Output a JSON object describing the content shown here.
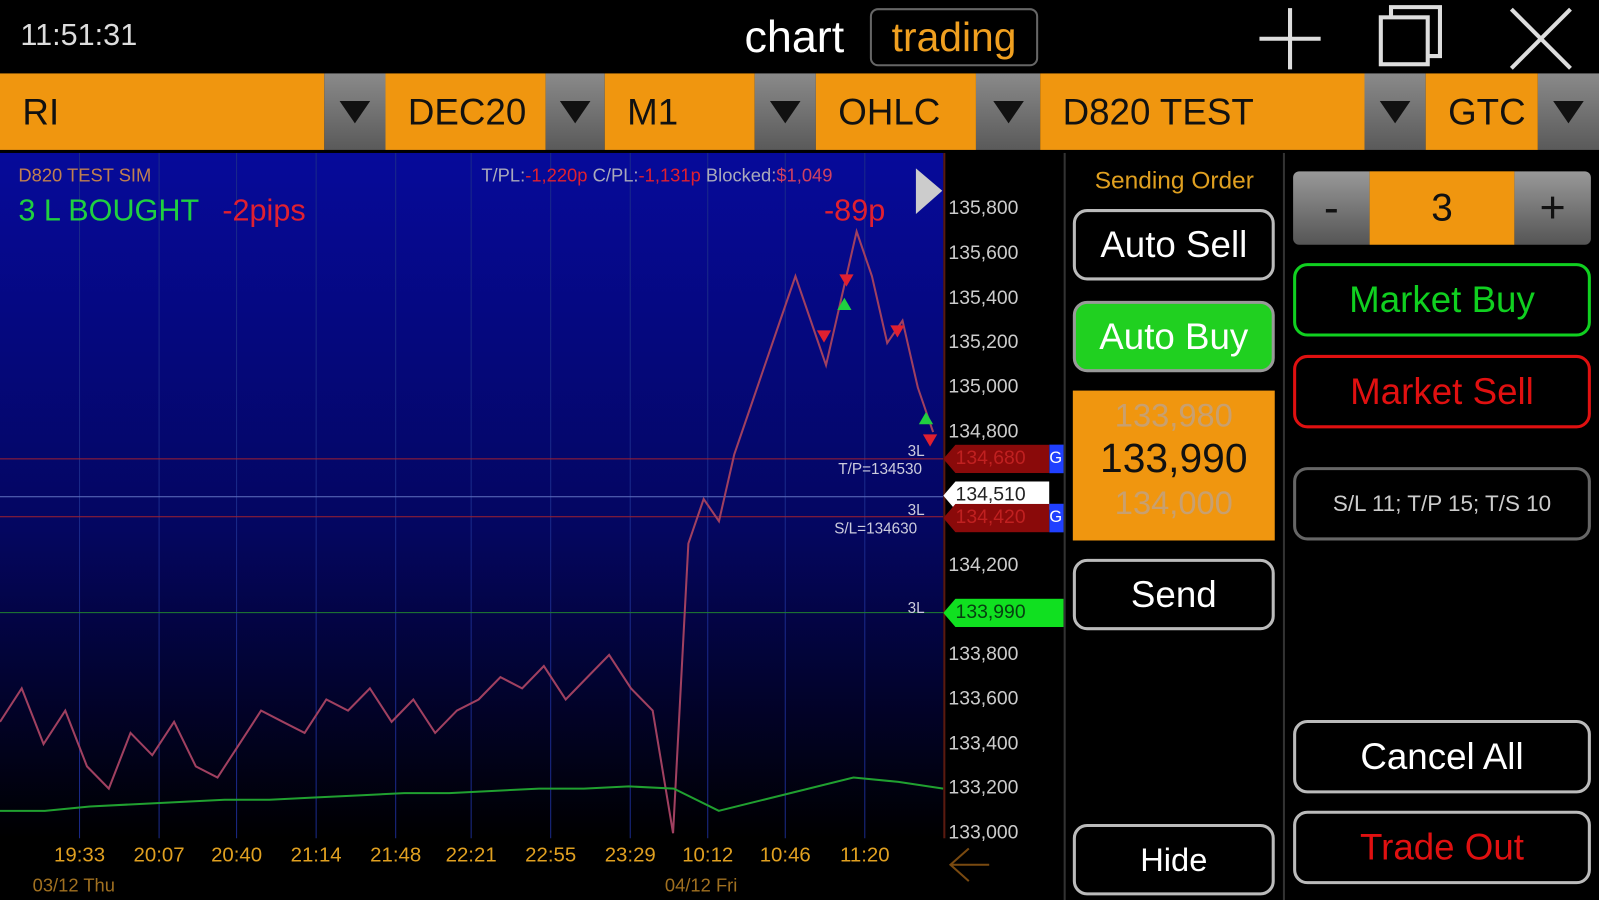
{
  "status_bar": {
    "time": "11:51:31"
  },
  "header": {
    "title": "chart",
    "mode": "trading",
    "icons": [
      "plus-icon",
      "window-icon",
      "close-icon"
    ]
  },
  "selectors": [
    {
      "label": "RI"
    },
    {
      "label": "DEC20"
    },
    {
      "label": "M1"
    },
    {
      "label": "OHLC"
    },
    {
      "label": "D820 TEST"
    },
    {
      "label": "GTC"
    }
  ],
  "chart": {
    "account": "D820 TEST SIM",
    "position": "3 L BOUGHT",
    "pips": "-2pips",
    "tpl_label": "T/PL:",
    "tpl_value": "-1,220p",
    "cpl_label": "C/PL:",
    "cpl_value": "-1,131p",
    "blocked_label": "Blocked:",
    "blocked_value": "$1,049",
    "open_pl": "-89p",
    "tp_text": "T/P=134530",
    "sl_text": "S/L=134630",
    "qty_tag": "3L",
    "price_tags": [
      {
        "value": "134,680",
        "kind": "tp",
        "badge": "G"
      },
      {
        "value": "134,510",
        "kind": "last"
      },
      {
        "value": "134,420",
        "kind": "sl",
        "badge": "G"
      },
      {
        "value": "133,990",
        "kind": "entry"
      }
    ],
    "dates": [
      "03/12 Thu",
      "04/12 Fri"
    ]
  },
  "chart_data": {
    "type": "line",
    "y_ticks": [
      "135,800",
      "135,600",
      "135,400",
      "135,200",
      "135,000",
      "134,800",
      "134,200",
      "133,800",
      "133,600",
      "133,400",
      "133,200",
      "133,000"
    ],
    "y_tick_values": [
      135800,
      135600,
      135400,
      135200,
      135000,
      134800,
      134200,
      133800,
      133600,
      133400,
      133200,
      133000
    ],
    "x_ticks": [
      "19:33",
      "20:07",
      "20:40",
      "21:14",
      "21:48",
      "22:21",
      "22:55",
      "23:29",
      "10:12",
      "10:46",
      "11:20"
    ],
    "ylim": [
      133000,
      135900
    ],
    "price": [
      133500,
      133650,
      133400,
      133550,
      133300,
      133200,
      133450,
      133350,
      133500,
      133300,
      133250,
      133400,
      133550,
      133500,
      133450,
      133600,
      133550,
      133650,
      133500,
      133600,
      133450,
      133550,
      133600,
      133700,
      133650,
      133750,
      133600,
      133700,
      133800,
      133650,
      133550,
      133000,
      134300,
      134500,
      134400,
      134700,
      134900,
      135100,
      135300,
      135500,
      135300,
      135100,
      135400,
      135700,
      135500,
      135200,
      135300,
      135000,
      134800
    ],
    "volume_line": [
      133100,
      133100,
      133120,
      133130,
      133140,
      133150,
      133150,
      133160,
      133170,
      133180,
      133180,
      133190,
      133200,
      133200,
      133210,
      133200,
      133100,
      133150,
      133200,
      133250,
      133230,
      133200
    ]
  },
  "order_panel": {
    "status": "Sending Order",
    "auto_sell": "Auto Sell",
    "auto_buy": "Auto Buy",
    "bid": "133,980",
    "mid": "133,990",
    "ask": "134,000",
    "send": "Send",
    "hide": "Hide"
  },
  "right_panel": {
    "qty": "3",
    "minus": "-",
    "plus": "+",
    "market_buy": "Market Buy",
    "market_sell": "Market Sell",
    "brackets": "S/L 11; T/P 15; T/S 10",
    "cancel_all": "Cancel All",
    "trade_out": "Trade Out"
  }
}
